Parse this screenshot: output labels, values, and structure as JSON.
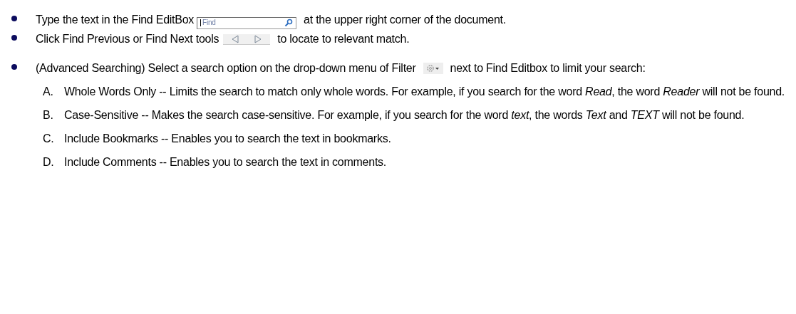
{
  "steps": [
    {
      "segments": [
        {
          "kind": "text",
          "text": "Type the text in the Find EditBox"
        },
        {
          "kind": "find_box",
          "placeholder": "Find"
        },
        {
          "kind": "text",
          "text": "at the upper right corner of the document."
        }
      ]
    },
    {
      "segments": [
        {
          "kind": "text",
          "text": "Click Find Previous or Find Next tools"
        },
        {
          "kind": "nav_buttons"
        },
        {
          "kind": "text",
          "text": "to locate to relevant match."
        }
      ]
    },
    {
      "segments": [
        {
          "kind": "text",
          "text": "(Advanced Searching) Select a search option on the drop-down menu of Filter"
        },
        {
          "kind": "filter_button"
        },
        {
          "kind": "text",
          "text": "next to Find Editbox to limit your search:"
        }
      ]
    }
  ],
  "options": [
    {
      "letter": "A.",
      "text": "Whole Words Only -- Limits the search to match only whole words. For example, if you search for the word *Read*, the word *Reader* will not be found."
    },
    {
      "letter": "B.",
      "text": "Case-Sensitive -- Makes the search case-sensitive. For example, if you search for the word *text*, the words *Text* and *TEXT* will not be found."
    },
    {
      "letter": "C.",
      "text": "Include Bookmarks -- Enables you to search the text in bookmarks."
    },
    {
      "letter": "D.",
      "text": "Include Comments -- Enables you to search the text in comments."
    }
  ]
}
